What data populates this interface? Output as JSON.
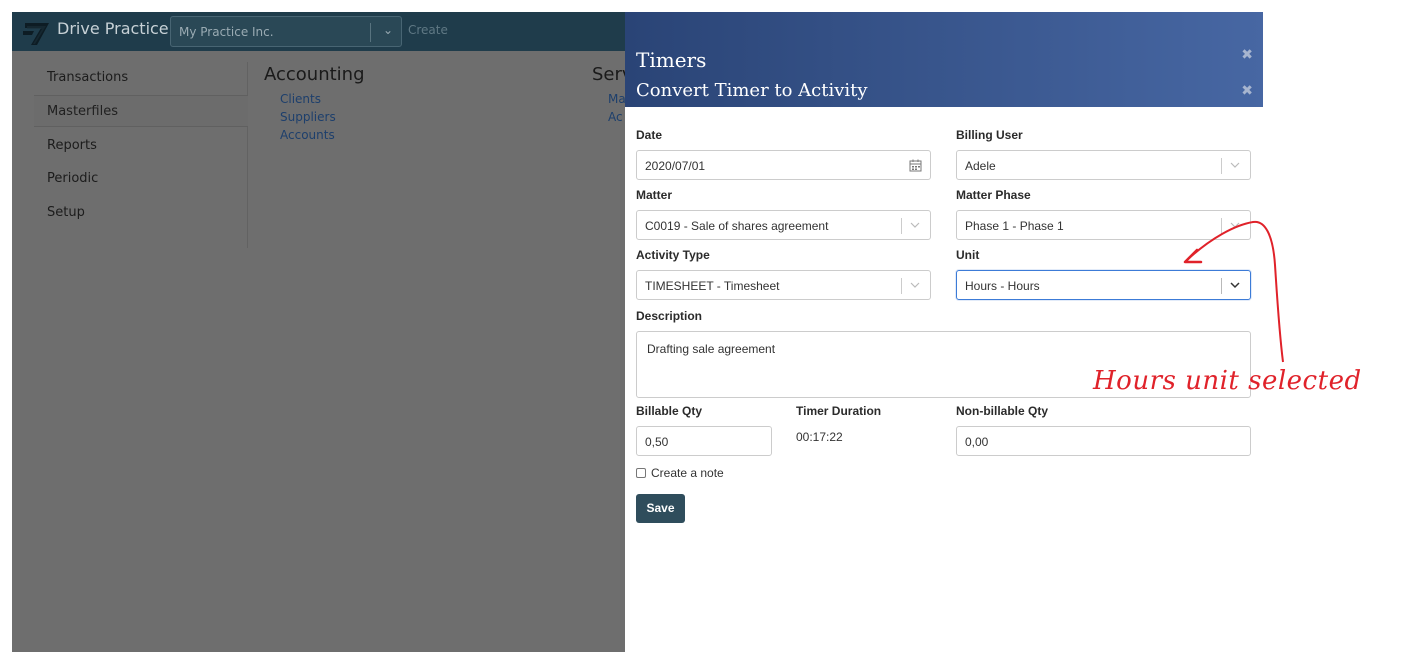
{
  "topbar": {
    "brand": "Drive Practice",
    "practice_value": "My Practice Inc.",
    "create_label": "Create"
  },
  "left_menu": {
    "items": [
      {
        "label": "Transactions"
      },
      {
        "label": "Masterfiles",
        "active": true
      },
      {
        "label": "Reports"
      },
      {
        "label": "Periodic"
      },
      {
        "label": "Setup"
      }
    ]
  },
  "main": {
    "accounting_title": "Accounting",
    "accounting_links": [
      "Clients",
      "Suppliers",
      "Accounts"
    ],
    "services_title_partial": "Serv",
    "services_links_partial": [
      "Ma",
      "Ac"
    ]
  },
  "modal": {
    "title": "Timers",
    "subtitle": "Convert Timer to Activity",
    "date_label": "Date",
    "date_value": "2020/07/01",
    "billing_user_label": "Billing User",
    "billing_user_value": "Adele",
    "matter_label": "Matter",
    "matter_value": "C0019 - Sale of shares agreement",
    "matter_phase_label": "Matter Phase",
    "matter_phase_value": "Phase 1 - Phase 1",
    "activity_type_label": "Activity Type",
    "activity_type_value": "TIMESHEET - Timesheet",
    "unit_label": "Unit",
    "unit_value": "Hours - Hours",
    "description_label": "Description",
    "description_value": "Drafting sale agreement",
    "billable_qty_label": "Billable Qty",
    "billable_qty_value": "0,50",
    "timer_duration_label": "Timer Duration",
    "timer_duration_value": "00:17:22",
    "non_billable_qty_label": "Non-billable Qty",
    "non_billable_qty_value": "0,00",
    "create_note_label": "Create a note",
    "save_label": "Save"
  },
  "annotation": {
    "text": "Hours unit selected",
    "color": "#e0222a"
  },
  "colors": {
    "topbar": "#1f3c4b",
    "modal_header_start": "#2a4476",
    "modal_header_end": "#4767a3",
    "save_button": "#2f4d5c",
    "focus_border": "#3c7bd7"
  }
}
